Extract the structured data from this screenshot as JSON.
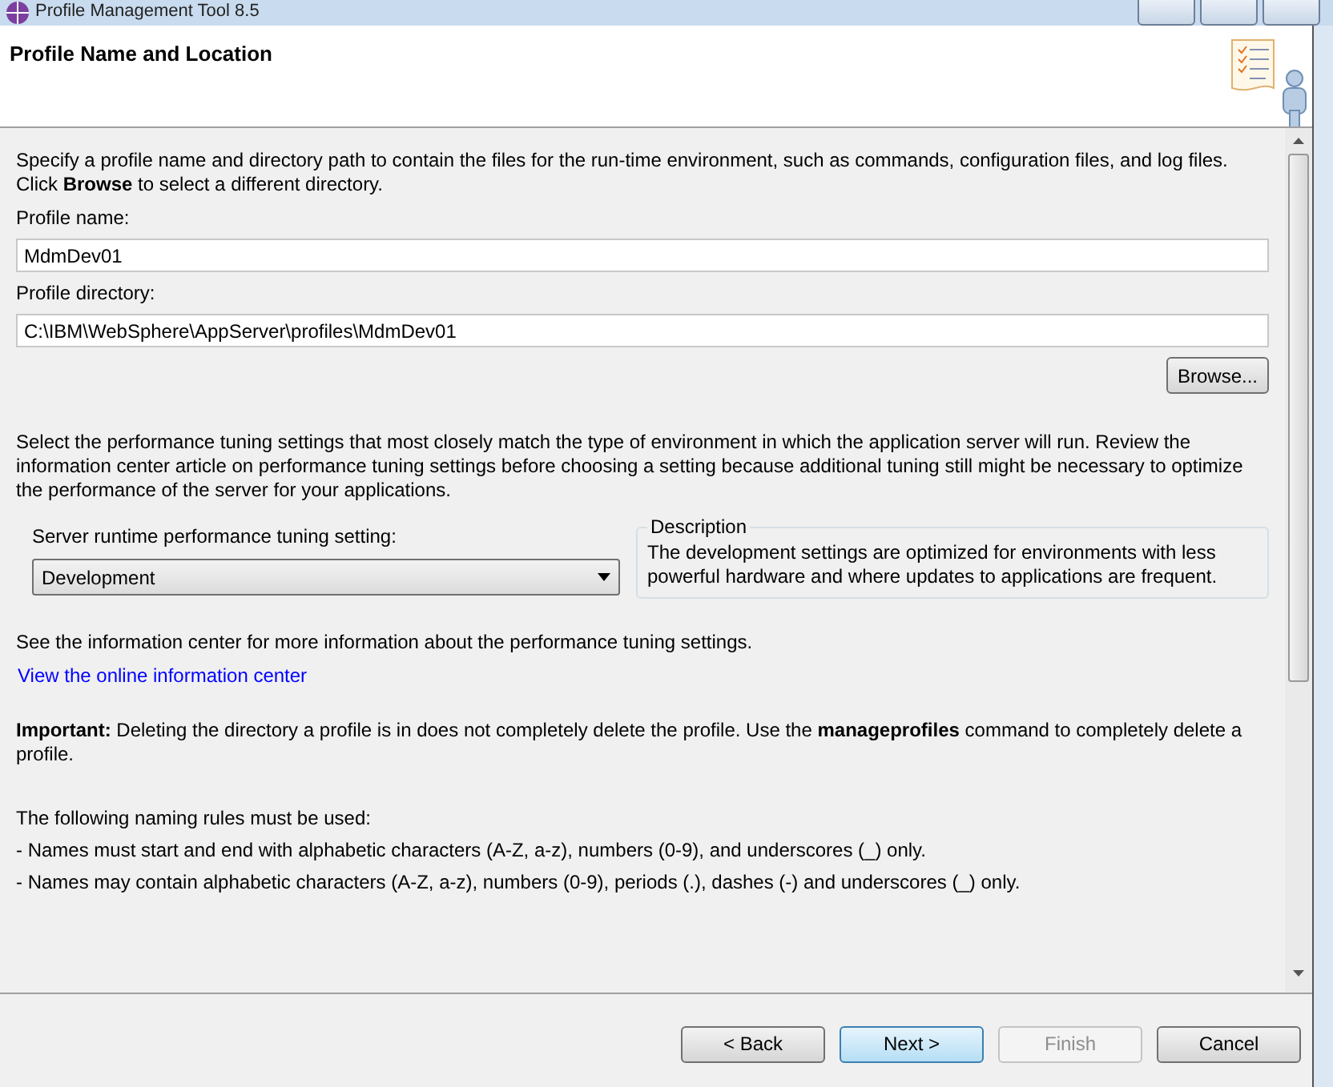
{
  "window": {
    "title": "Profile Management Tool 8.5"
  },
  "header": {
    "title": "Profile Name and Location"
  },
  "intro": "Specify a profile name and directory path to contain the files for the run-time environment, such as commands, configuration files, and log files. Click **Browse** to select a different directory.",
  "fields": [
    {
      "label": "Profile name:",
      "value": "MdmDev01"
    },
    {
      "label": "Profile directory:",
      "value": "C:\\IBM\\WebSphere\\AppServer\\profiles\\MdmDev01"
    }
  ],
  "browse_button": "Browse...",
  "tuning_text": "Select the performance tuning settings that most closely match the type of environment in which the application server will run. Review the information center article on performance tuning settings before choosing a setting because additional tuning still might be necessary to optimize the performance of the server for your applications.",
  "tuning": {
    "label": "Server runtime performance tuning setting:",
    "value": "Development"
  },
  "description": {
    "title": "Description",
    "text": "The development settings are optimized for environments with less powerful hardware and where updates to applications are frequent."
  },
  "info_text": "See the information center for more information about the performance tuning settings.",
  "info_link": "View the online information center",
  "important": "**Important:** Deleting the directory a profile is in does not completely delete the profile. Use the **manageprofiles** command to completely delete a profile.",
  "rules_heading": "The following naming rules must be used:",
  "rules": [
    "- Names must start and end with alphabetic characters (A-Z, a-z), numbers (0-9), and underscores (_) only.",
    "- Names may contain alphabetic characters (A-Z, a-z), numbers (0-9), periods (.), dashes (-) and underscores (_) only."
  ],
  "buttons": [
    {
      "label": "< Back",
      "disabled": false,
      "default": false
    },
    {
      "label": "Next >",
      "disabled": false,
      "default": true
    },
    {
      "label": "Finish",
      "disabled": true,
      "default": false
    },
    {
      "label": "Cancel",
      "disabled": false,
      "default": false
    }
  ]
}
